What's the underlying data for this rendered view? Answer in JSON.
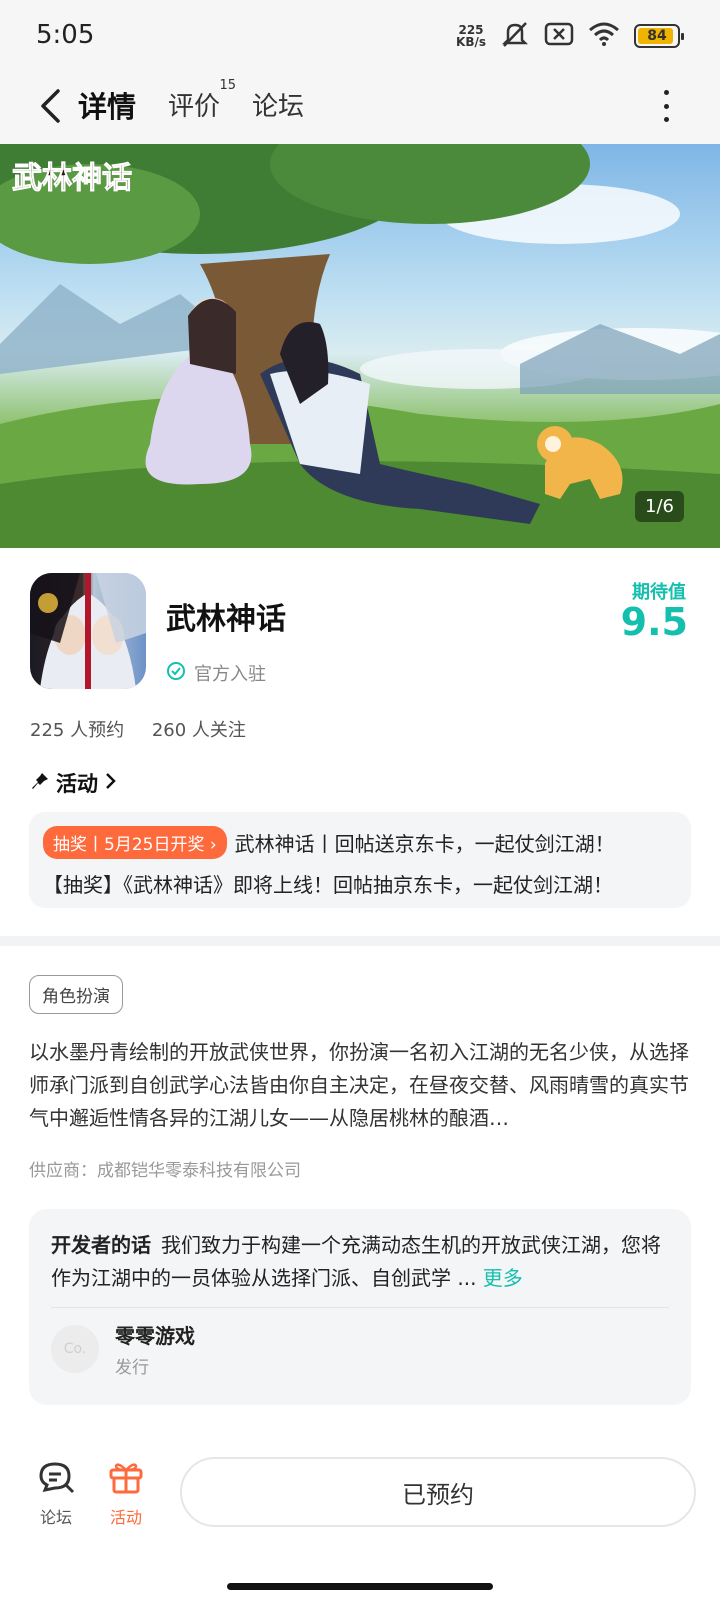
{
  "status_bar": {
    "time": "5:05",
    "net_speed_value": "225",
    "net_speed_unit": "KB/s",
    "battery_level": "84"
  },
  "nav": {
    "tabs": [
      {
        "label": "详情",
        "active": true
      },
      {
        "label": "评价",
        "badge": "15"
      },
      {
        "label": "论坛"
      }
    ]
  },
  "banner": {
    "logo_text": "武林神话",
    "counter": "1/6"
  },
  "app": {
    "name": "武林神话",
    "official_label": "官方入驻",
    "expect_label": "期待值",
    "expect_value": "9.5",
    "reservations": "225 人预约",
    "followers": "260 人关注"
  },
  "activity": {
    "heading": "活动",
    "tag": "抽奖丨5月25日开奖",
    "title": "武林神话丨回帖送京东卡，一起仗剑江湖！",
    "subtitle": "【抽奖】《武林神话》即将上线！回帖抽京东卡，一起仗剑江湖！"
  },
  "details": {
    "genre": "角色扮演",
    "description": "以水墨丹青绘制的开放武侠世界，你扮演一名初入江湖的无名少侠，从选择师承门派到自创武学心法皆由你自主决定，在昼夜交替、风雨晴雪的真实节气中邂逅性情各异的江湖儿女——从隐居桃林的酿酒…",
    "supplier": "供应商：成都铠华零泰科技有限公司"
  },
  "developer": {
    "title": "开发者的话",
    "text": "我们致力于构建一个充满动态生机的开放武侠江湖，您将作为江湖中的一员体验从选择门派、自创武学 ...",
    "more": "更多",
    "avatar_text": "Co.",
    "publisher_name": "零零游戏",
    "publisher_role": "发行"
  },
  "bottom_bar": {
    "forum_label": "论坛",
    "activity_label": "活动",
    "reserve_label": "已预约"
  },
  "colors": {
    "accent": "#15bfae",
    "orange": "#ff6a3c"
  }
}
